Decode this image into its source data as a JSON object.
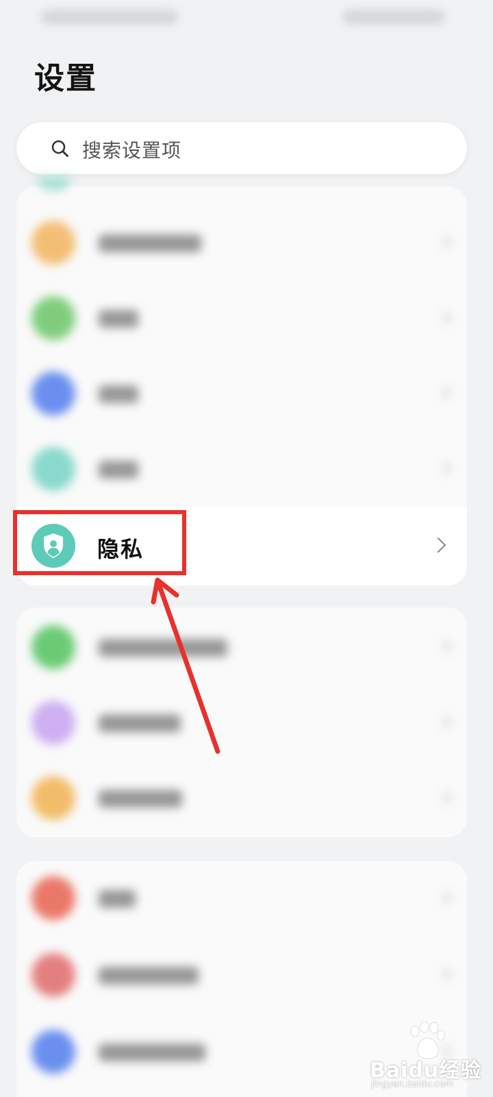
{
  "header": {
    "title": "设置"
  },
  "search": {
    "placeholder": "搜索设置项"
  },
  "privacy": {
    "label": "隐私"
  },
  "watermark": {
    "text": "Baidu经验",
    "url": "jingyan.baidu.com"
  },
  "colors": {
    "accent_privacy": "#5ccbb8",
    "highlight": "#e8312b",
    "background": "#f1f2f4"
  },
  "blurred_rows": [
    {
      "icon_color": "#f4b766"
    },
    {
      "icon_color": "#72c96f"
    },
    {
      "icon_color": "#5b84ee"
    },
    {
      "icon_color": "#7dd6c8"
    },
    {
      "icon_color": "#5cc667"
    },
    {
      "icon_color": "#c9a7f2"
    },
    {
      "icon_color": "#f2b65a"
    },
    {
      "icon_color": "#e96a5a"
    },
    {
      "icon_color": "#e27272"
    },
    {
      "icon_color": "#5b84ee"
    }
  ]
}
